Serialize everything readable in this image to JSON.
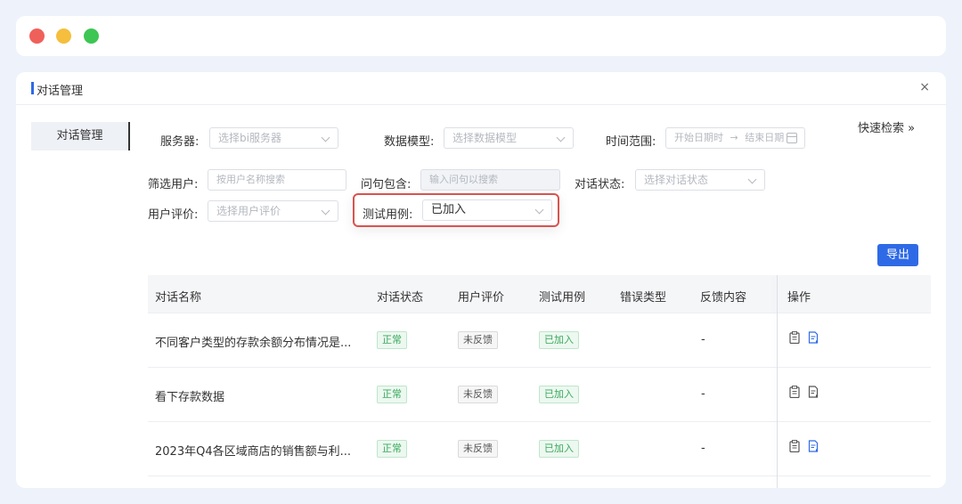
{
  "window": {
    "title": "对话管理",
    "close_glyph": "×"
  },
  "sidebar": {
    "active_tab": "对话管理"
  },
  "filters": {
    "server_label": "服务器:",
    "server_placeholder": "选择bi服务器",
    "model_label": "数据模型:",
    "model_placeholder": "选择数据模型",
    "time_label": "时间范围:",
    "time_start_placeholder": "开始日期时",
    "time_arrow": "→",
    "time_end_placeholder": "结束日期",
    "user_label": "筛选用户:",
    "user_placeholder": "按用户名称搜索",
    "question_label": "问句包含:",
    "question_placeholder": "输入问句以搜索",
    "status_label": "对话状态:",
    "status_placeholder": "选择对话状态",
    "rating_label": "用户评价:",
    "rating_placeholder": "选择用户评价",
    "testcase_label": "测试用例:",
    "testcase_value": "已加入"
  },
  "quick_search": "快速检索 »",
  "export_label": "导出",
  "table": {
    "headers": [
      "对话名称",
      "对话状态",
      "用户评价",
      "测试用例",
      "错误类型",
      "反馈内容",
      "操作"
    ],
    "rows": [
      {
        "name": "不同客户类型的存款余额分布情况是...",
        "status": "正常",
        "rating": "未反馈",
        "testcase": "已加入",
        "error": "",
        "feedback": "-"
      },
      {
        "name": "看下存款数据",
        "status": "正常",
        "rating": "未反馈",
        "testcase": "已加入",
        "error": "",
        "feedback": "-"
      },
      {
        "name": "2023年Q4各区域商店的销售额与利...",
        "status": "正常",
        "rating": "未反馈",
        "testcase": "已加入",
        "error": "",
        "feedback": "-"
      }
    ]
  },
  "colors": {
    "accent": "#2f6ae6",
    "highlight_border": "#d9534f",
    "tag_green": "#3aa95c"
  }
}
